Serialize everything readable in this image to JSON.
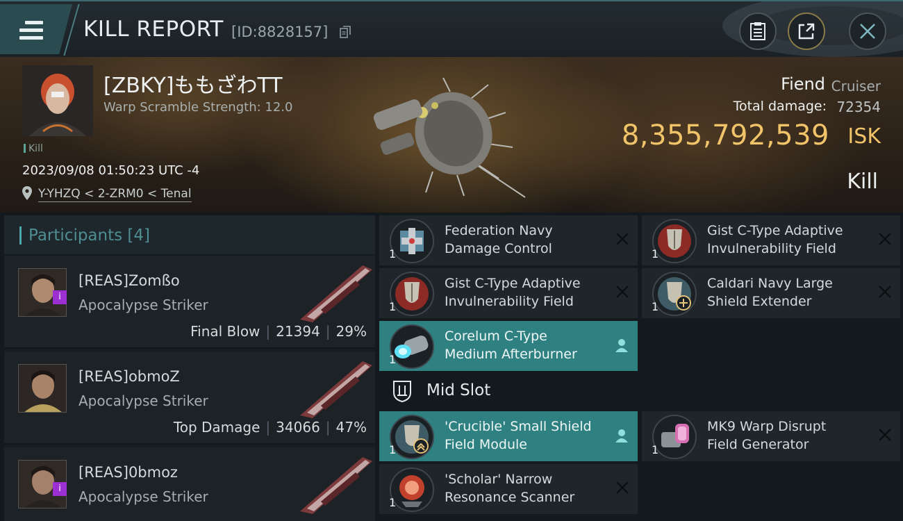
{
  "header": {
    "title": "KILL REPORT",
    "id_label": "[ID:8828157]"
  },
  "victim": {
    "pilot_name": "[ZBKY]ももざわTT",
    "warp_scramble": "Warp Scramble Strength: 12.0",
    "tag": "Kill",
    "datetime": "2023/09/08 01:50:23 UTC -4",
    "location": "Y-YHZQ < 2-ZRM0 < Tenal",
    "ship_name": "Fiend",
    "ship_class": "Cruiser",
    "total_damage_label": "Total damage:",
    "total_damage": "72354",
    "isk_value": "8,355,792,539",
    "isk_unit": "ISK",
    "status": "Kill"
  },
  "participants": {
    "title": "Participants",
    "count": "[4]",
    "items": [
      {
        "name": "[REAS]Zomßo",
        "ship": "Apocalypse Striker",
        "stat_label": "Final Blow",
        "damage": "21394",
        "percent": "29%"
      },
      {
        "name": "[REAS]obmoZ",
        "ship": "Apocalypse Striker",
        "stat_label": "Top Damage",
        "damage": "34066",
        "percent": "47%"
      },
      {
        "name": "[REAS]0bmoz",
        "ship": "Apocalypse Striker"
      }
    ]
  },
  "modules": {
    "low_left": [
      {
        "name": "Federation Navy\nDamage Control",
        "qty": "1",
        "state": "destroyed"
      },
      {
        "name": "Gist C-Type Adaptive\nInvulnerability Field",
        "qty": "1",
        "state": "destroyed"
      },
      {
        "name": "Corelum C-Type\nMedium Afterburner",
        "qty": "1",
        "state": "dropped"
      }
    ],
    "low_right": [
      {
        "name": "Gist C-Type Adaptive\nInvulnerability Field",
        "qty": "1",
        "state": "destroyed"
      },
      {
        "name": "Caldari Navy Large\nShield Extender",
        "qty": "1",
        "state": "destroyed"
      }
    ],
    "mid_slot_label": "Mid Slot",
    "mid": [
      {
        "name": "'Crucible' Small Shield\n Field Module",
        "qty": "1",
        "state": "dropped"
      },
      {
        "name": "MK9 Warp Disrupt\nField Generator",
        "qty": "1",
        "state": "destroyed"
      },
      {
        "name": "'Scholar' Narrow\nResonance Scanner",
        "qty": "1",
        "state": "destroyed"
      }
    ]
  },
  "colors": {
    "accent_teal": "#2f8081",
    "isk_gold": "#f1c46a",
    "badge_purple": "#9b2fd1"
  }
}
